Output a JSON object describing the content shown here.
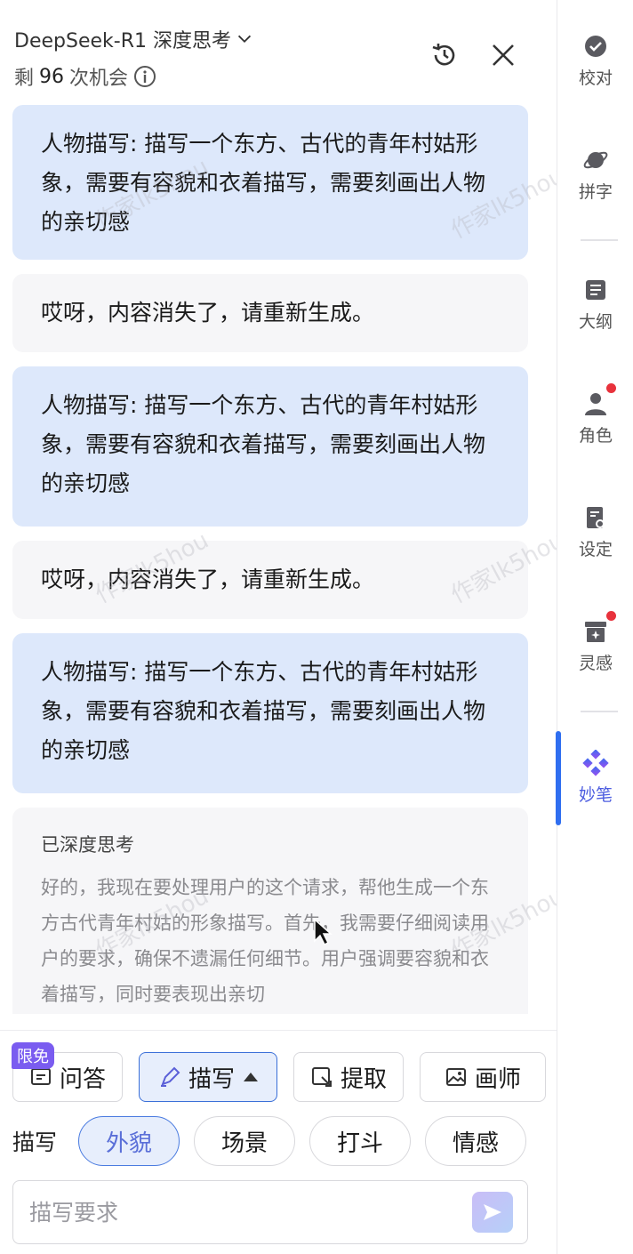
{
  "header": {
    "model_name": "DeepSeek-R1 深度思考",
    "remain_prefix": "剩",
    "remain_count": "96",
    "remain_suffix": "次机会"
  },
  "messages": [
    {
      "role": "user",
      "text": "人物描写: 描写一个东方、古代的青年村姑形象，需要有容貌和衣着描写，需要刻画出人物的亲切感"
    },
    {
      "role": "bot",
      "text": "哎呀，内容消失了，请重新生成。"
    },
    {
      "role": "user",
      "text": "人物描写: 描写一个东方、古代的青年村姑形象，需要有容貌和衣着描写，需要刻画出人物的亲切感"
    },
    {
      "role": "bot",
      "text": "哎呀，内容消失了，请重新生成。"
    },
    {
      "role": "user",
      "text": "人物描写: 描写一个东方、古代的青年村姑形象，需要有容貌和衣着描写，需要刻画出人物的亲切感"
    }
  ],
  "thinking": {
    "title": "已深度思考",
    "body": "好的，我现在要处理用户的这个请求，帮他生成一个东方古代青年村姑的形象描写。首先，我需要仔细阅读用户的要求，确保不遗漏任何细节。用户强调要容貌和衣着描写，同时要表现出亲切"
  },
  "watermark": "作家lk5hou",
  "tools": {
    "qa_badge": "限免",
    "qa": "问答",
    "describe": "描写",
    "extract": "提取",
    "painter": "画师"
  },
  "chips": {
    "label": "描写",
    "items": [
      "外貌",
      "场景",
      "打斗",
      "情感"
    ],
    "selected": "外貌"
  },
  "input": {
    "placeholder": "描写要求"
  },
  "sidebar": {
    "items": [
      {
        "label": "校对",
        "icon": "check-badge-icon"
      },
      {
        "label": "拼字",
        "icon": "planet-icon"
      },
      {
        "label": "大纲",
        "icon": "outline-list-icon"
      },
      {
        "label": "角色",
        "icon": "person-icon"
      },
      {
        "label": "设定",
        "icon": "settings-doc-icon"
      },
      {
        "label": "灵感",
        "icon": "inspiration-box-icon"
      },
      {
        "label": "妙笔",
        "icon": "diamond-cluster-icon"
      }
    ]
  },
  "colors": {
    "accent": "#2f6ef0",
    "user_bubble": "#dde8fb",
    "bot_bubble": "#f6f6f8",
    "badge": "#7a5cf0",
    "notify_dot": "#e8323c"
  }
}
